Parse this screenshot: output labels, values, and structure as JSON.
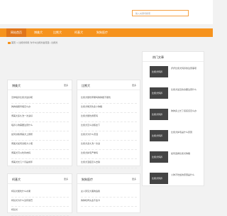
{
  "search": {
    "placeholder": "输入关键词搜索"
  },
  "nav": [
    {
      "label": "网站首页",
      "active": true
    },
    {
      "label": "博美犬",
      "active": false
    },
    {
      "label": "比熊犬",
      "active": false
    },
    {
      "label": "柯基犬",
      "active": false
    },
    {
      "label": "狗狗医疗",
      "active": false
    }
  ],
  "breadcrumb": "首页 > 比熊犬饲养 为什么比熊犬会流泪…比熊犬",
  "sections": [
    {
      "title": "博美犬",
      "more": "更多",
      "items": [
        "怎样喂养比熊犬最好呢",
        "狗狗得肠胃病怎么办",
        "博美犬多久洗一次澡好",
        "喂养小狗需要注意什么",
        "如何训练博美犬上厕所",
        "博美犬如何训练大小便",
        "博美犬可以吃鸡肉吗",
        "博美犬长几个月是成年"
      ]
    },
    {
      "title": "比熊犬",
      "more": "更多",
      "items": [
        "比熊犬能吃苹果吗狗狗能不能吃",
        "比熊犬每天吃多少狗粮",
        "比熊犬能吃香蕉吗",
        "比熊犬怎么训练坐下",
        "比熊犬为什么流泪",
        "比熊犬多久洗一次澡",
        "比熊犬掉毛严重吗",
        "比熊犬泪痕怎么去除"
      ]
    },
    {
      "title": "柯基犬",
      "more": "更多",
      "items": [
        "柯基犬能吃什么水果",
        "柯基犬为什么没有尾巴",
        "柯基犬"
      ]
    },
    {
      "title": "狗狗医疗",
      "more": "更多",
      "items": [
        "女人梦见大黑狗追我",
        "狗狗吃骨头会不会卡"
      ]
    }
  ],
  "sidebar": {
    "title": "热门文章",
    "items": [
      {
        "thumb": "比熊犬饲养",
        "text": "乔乔比熊犬饲养的注意事项"
      },
      {
        "thumb": "比熊犬饲养",
        "text": "比熊犬最近饮食要注意什么"
      },
      {
        "thumb": "比熊犬饲养",
        "text": "狗狗身上长了痘痘该怎么办"
      },
      {
        "thumb": "比熊犬饲养",
        "text": "比熊犬掉毛是什么原因"
      },
      {
        "thumb": "比熊犬饲养",
        "text": "如何选择比熊犬狗粮"
      },
      {
        "thumb": "比熊犬饲养",
        "text": "小狗不吃饭的原因是什么"
      }
    ]
  }
}
